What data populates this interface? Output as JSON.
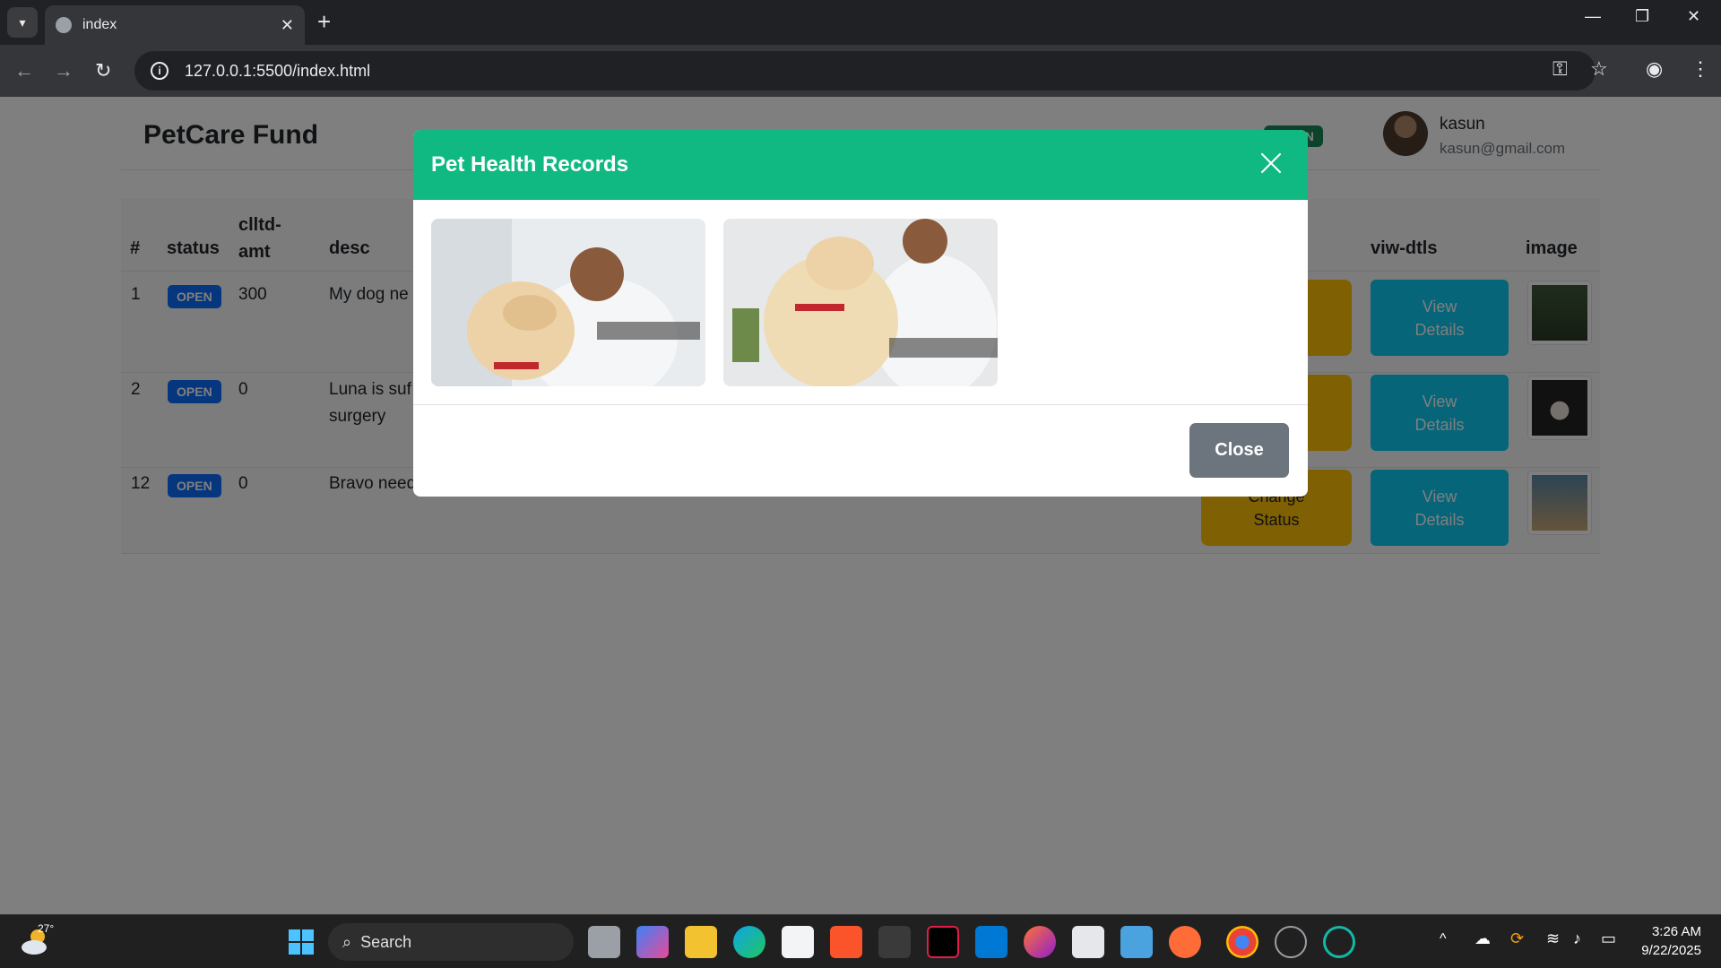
{
  "browser": {
    "tab_title": "index",
    "url": "127.0.0.1:5500/index.html",
    "new_tab_symbol": "+"
  },
  "navbar": {
    "brand": "PetCare Fund",
    "badge": "ADMIN",
    "user_name": "kasun",
    "user_email": "kasun@gmail.com"
  },
  "table": {
    "headers": [
      "#",
      "status",
      "clltd-amt",
      "desc",
      "viw-dtls",
      "image"
    ],
    "rows": [
      {
        "id": "1",
        "status": "OPEN",
        "amount": "300",
        "desc": "My dog ne",
        "view": "View Details"
      },
      {
        "id": "2",
        "status": "OPEN",
        "amount": "0",
        "desc": "Luna is suf",
        "desc2": "surgery",
        "view": "View Details"
      },
      {
        "id": "12",
        "status": "OPEN",
        "amount": "0",
        "desc": "Bravo need",
        "action": "Change Status",
        "view": "View Details"
      }
    ]
  },
  "modal": {
    "title": "Pet Health Records",
    "images": [
      "vet-examining-dog-1",
      "vet-examining-dog-2"
    ],
    "close_label": "Close"
  },
  "taskbar": {
    "weather_temp": "27°",
    "search_placeholder": "Search",
    "time": "3:26 AM",
    "date": "9/22/2025"
  },
  "colors": {
    "modal_header": "#10b981",
    "badge_open": "#0d6efd",
    "btn_warning": "#ffc107",
    "btn_info": "#0dcaf0",
    "btn_secondary": "#6c757d"
  }
}
